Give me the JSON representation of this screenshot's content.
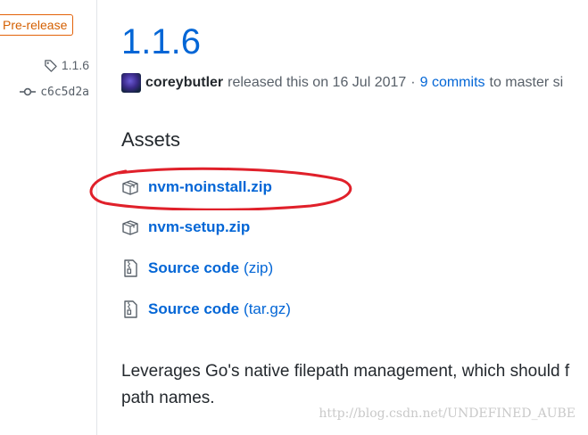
{
  "sidebar": {
    "badge": "Pre-release",
    "tag_label": "1.1.6",
    "tag_icon": "tag-icon",
    "commit_label": "c6c5d2a",
    "commit_icon": "commit-icon"
  },
  "release": {
    "title": "1.1.6",
    "author": "coreybutler",
    "released_text": "released this on 16 Jul 2017",
    "separator": "·",
    "commits_link": "9 commits",
    "to_branch_text": "to master si"
  },
  "assets": {
    "title": "Assets",
    "items": [
      {
        "name": "nvm-noinstall.zip",
        "suffix": "",
        "icon": "package-icon"
      },
      {
        "name": "nvm-setup.zip",
        "suffix": "",
        "icon": "package-icon"
      },
      {
        "name": "Source code",
        "suffix": "(zip)",
        "icon": "file-zip-icon"
      },
      {
        "name": "Source code",
        "suffix": "(tar.gz)",
        "icon": "file-zip-icon"
      }
    ]
  },
  "description": {
    "line1": "Leverages Go's native filepath management, which should f",
    "line2": "path names."
  },
  "watermark": "http://blog.csdn.net/UNDEFINED_AUBE",
  "colors": {
    "link": "#0366d6",
    "prerelease": "#e36209",
    "annotation": "#e0202a"
  }
}
